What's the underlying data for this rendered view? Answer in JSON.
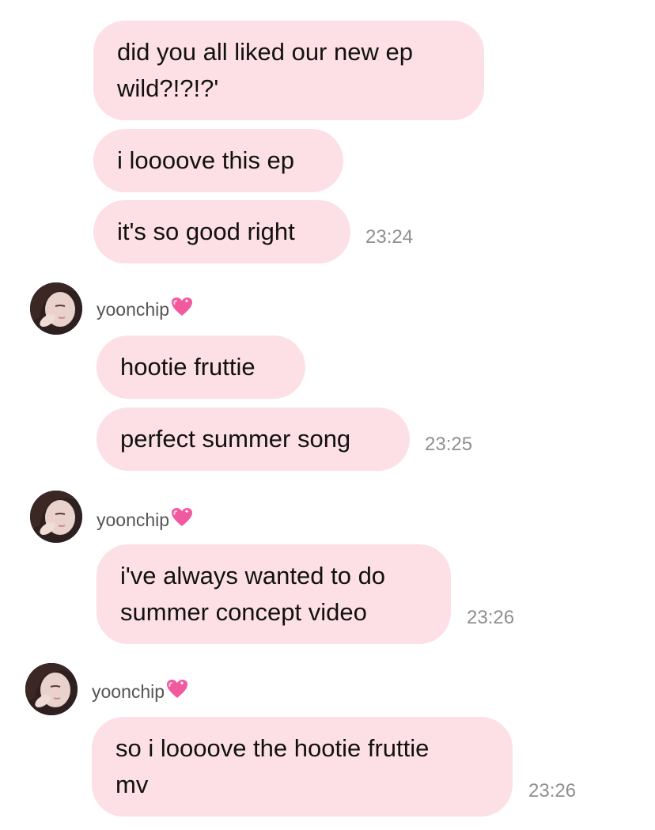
{
  "messages": {
    "m1": "did you all liked our new ep\nwild?!?!?'",
    "m2": "i loooove this ep",
    "m3": "it's so good right",
    "m4": "hootie fruttie",
    "m5": "perfect summer song",
    "m6": "i've always wanted to do\nsummer concept video",
    "m7": "so i loooove the hootie fruttie\nmv"
  },
  "times": {
    "t1": "23:24",
    "t2": "23:25",
    "t3": "23:26",
    "t4": "23:26"
  },
  "sender": {
    "name": "yoonchip",
    "name_icon": "pink-heart-icon"
  },
  "colors": {
    "bubble": "#fde0e5",
    "timestamp": "#8f8f8f",
    "heart": "#f25aa0"
  }
}
